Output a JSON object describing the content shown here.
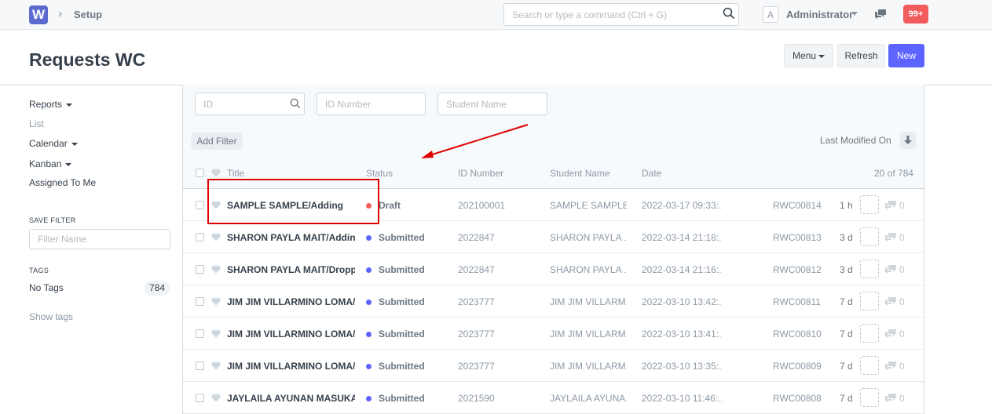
{
  "navbar": {
    "logo_letter": "W",
    "breadcrumb": "Setup",
    "search_placeholder": "Search or type a command (Ctrl + G)",
    "avatar_letter": "A",
    "user_name": "Administrator",
    "notification_count": "99+"
  },
  "page": {
    "title": "Requests WC",
    "menu_label": "Menu",
    "refresh_label": "Refresh",
    "new_label": "New",
    "accent_color": "#5e64ff"
  },
  "sidebar": {
    "reports": "Reports",
    "list": "List",
    "calendar": "Calendar",
    "kanban": "Kanban",
    "assigned": "Assigned To Me",
    "save_filter_label": "SAVE FILTER",
    "filter_name_placeholder": "Filter Name",
    "tags_label": "TAGS",
    "no_tags": "No Tags",
    "no_tags_count": "784",
    "show_tags": "Show tags"
  },
  "filters": {
    "id_placeholder": "ID",
    "id_number_placeholder": "ID Number",
    "student_name_placeholder": "Student Name",
    "add_filter": "Add Filter",
    "sort_label": "Last Modified On"
  },
  "columns": {
    "title": "Title",
    "status": "Status",
    "id_number": "ID Number",
    "student_name": "Student Name",
    "date": "Date",
    "count": "20 of 784"
  },
  "rows": [
    {
      "title": "SAMPLE SAMPLE/Adding",
      "status": "Draft",
      "status_color": "#f35c5c",
      "id_number": "202100001",
      "student": "SAMPLE SAMPLE",
      "date": "2022-03-17 09:33:...",
      "name": "RWC00814",
      "modified": "1 h",
      "comments": "0"
    },
    {
      "title": "SHARON PAYLA MAIT/Adding",
      "status": "Submitted",
      "status_color": "#5e64ff",
      "id_number": "2022847",
      "student": "SHARON PAYLA ...",
      "date": "2022-03-14 21:18:...",
      "name": "RWC00813",
      "modified": "3 d",
      "comments": "0"
    },
    {
      "title": "SHARON PAYLA MAIT/Dropping",
      "status": "Submitted",
      "status_color": "#5e64ff",
      "id_number": "2022847",
      "student": "SHARON PAYLA ...",
      "date": "2022-03-14 21:16:...",
      "name": "RWC00812",
      "modified": "3 d",
      "comments": "0"
    },
    {
      "title": "JIM JIM VILLARMINO LOMA/",
      "status": "Submitted",
      "status_color": "#5e64ff",
      "id_number": "2023777",
      "student": "JIM JIM VILLARM...",
      "date": "2022-03-10 13:42:...",
      "name": "RWC00811",
      "modified": "7 d",
      "comments": "0"
    },
    {
      "title": "JIM JIM VILLARMINO LOMA/",
      "status": "Submitted",
      "status_color": "#5e64ff",
      "id_number": "2023777",
      "student": "JIM JIM VILLARM...",
      "date": "2022-03-10 13:41:...",
      "name": "RWC00810",
      "modified": "7 d",
      "comments": "0"
    },
    {
      "title": "JIM JIM VILLARMINO LOMA/",
      "status": "Submitted",
      "status_color": "#5e64ff",
      "id_number": "2023777",
      "student": "JIM JIM VILLARM...",
      "date": "2022-03-10 13:35:...",
      "name": "RWC00809",
      "modified": "7 d",
      "comments": "0"
    },
    {
      "title": "JAYLAILA AYUNAN MASUKAT",
      "status": "Submitted",
      "status_color": "#5e64ff",
      "id_number": "2021590",
      "student": "JAYLAILA AYUNA...",
      "date": "2022-03-10 11:46:...",
      "name": "RWC00808",
      "modified": "7 d",
      "comments": "0"
    }
  ]
}
